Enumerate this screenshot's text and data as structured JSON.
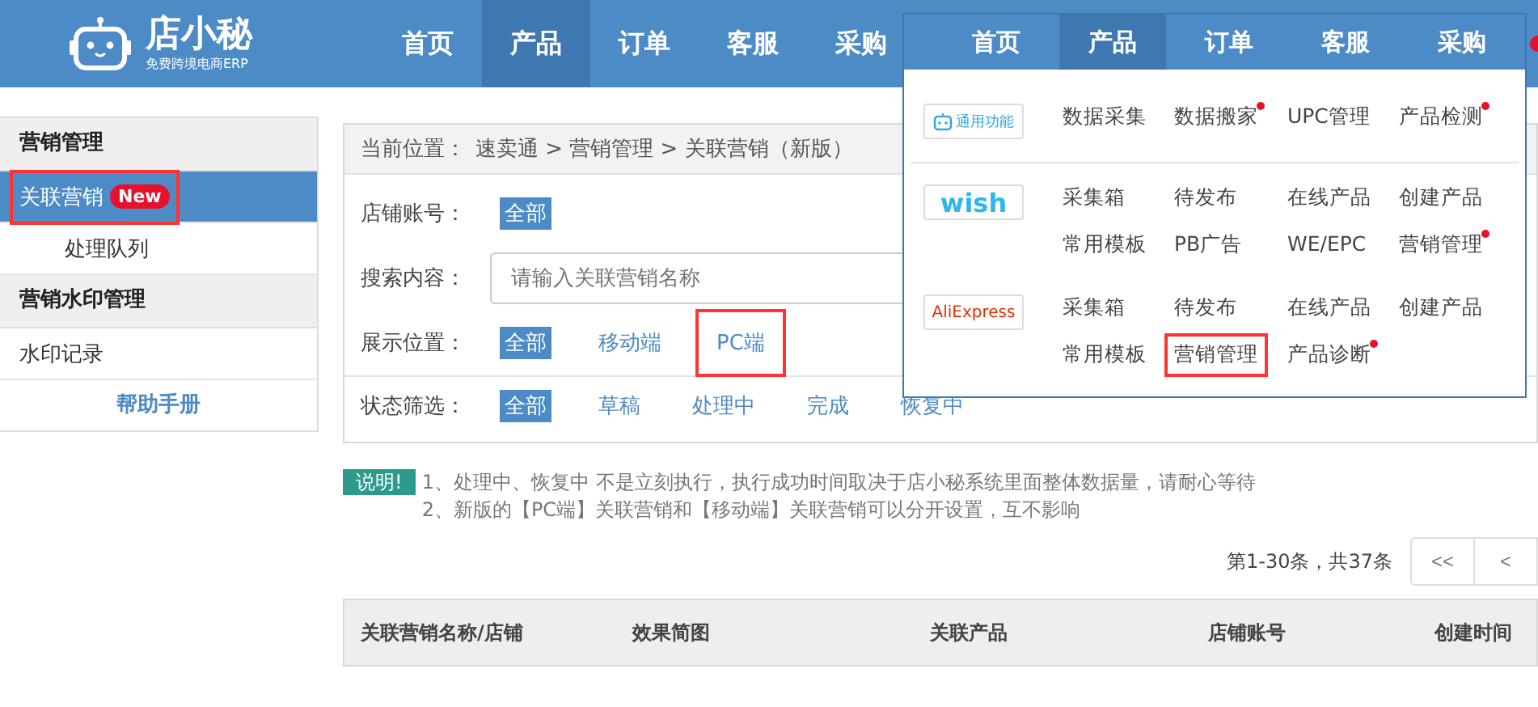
{
  "header": {
    "logo": {
      "name": "店小秘",
      "tagline": "免费跨境电商ERP"
    },
    "nav": [
      {
        "label": "首页",
        "selected": false
      },
      {
        "label": "产品",
        "selected": true
      },
      {
        "label": "订单",
        "selected": false
      },
      {
        "label": "客服",
        "selected": false
      },
      {
        "label": "采购",
        "selected": false
      }
    ]
  },
  "sidebar": [
    {
      "title": "营销管理",
      "items": [
        {
          "label": "关联营销",
          "badge": "New",
          "selected": true,
          "highlighted": true,
          "sub": false
        },
        {
          "label": "处理队列",
          "selected": false,
          "highlighted": false,
          "sub": true
        }
      ]
    },
    {
      "title": "营销水印管理",
      "items": [
        {
          "label": "水印记录",
          "selected": false,
          "highlighted": false,
          "sub": false
        }
      ]
    }
  ],
  "help_link": "帮助手册",
  "breadcrumb": {
    "label": "当前位置：",
    "path": "速卖通 > 营销管理 > 关联营销（新版）"
  },
  "filters": [
    {
      "kind": "chips",
      "label": "店铺账号：",
      "options": [
        {
          "label": "全部",
          "selected": true,
          "highlighted": false
        }
      ]
    },
    {
      "kind": "search",
      "label": "搜索内容：",
      "placeholder": "请输入关联营销名称"
    },
    {
      "kind": "chips",
      "label": "展示位置：",
      "options": [
        {
          "label": "全部",
          "selected": true,
          "highlighted": false
        },
        {
          "label": "移动端",
          "selected": false,
          "highlighted": false
        },
        {
          "label": "PC端",
          "selected": false,
          "highlighted": true
        }
      ]
    },
    {
      "kind": "chips",
      "label": "状态筛选：",
      "options": [
        {
          "label": "全部",
          "selected": true,
          "highlighted": false
        },
        {
          "label": "草稿",
          "selected": false,
          "highlighted": false
        },
        {
          "label": "处理中",
          "selected": false,
          "highlighted": false
        },
        {
          "label": "完成",
          "selected": false,
          "highlighted": false
        },
        {
          "label": "恢复中",
          "selected": false,
          "highlighted": false
        }
      ]
    }
  ],
  "notice": {
    "badge": "说明!",
    "lines": [
      "1、处理中、恢复中 不是立刻执行，执行成功时间取决于店小秘系统里面整体数据量，请耐心等待",
      "2、新版的【PC端】关联营销和【移动端】关联营销可以分开设置，互不影响"
    ]
  },
  "pagination": {
    "summary": "第1-30条，共37条",
    "buttons": [
      "<<",
      "<"
    ]
  },
  "table": {
    "columns": [
      "关联营销名称/店铺",
      "效果简图",
      "关联产品",
      "店铺账号",
      "创建时间"
    ]
  },
  "dropdown": {
    "nav": [
      {
        "label": "首页",
        "selected": false
      },
      {
        "label": "产品",
        "selected": true
      },
      {
        "label": "订单",
        "selected": false
      },
      {
        "label": "客服",
        "selected": false
      },
      {
        "label": "采购",
        "selected": false
      }
    ],
    "sections": [
      {
        "kind": "general",
        "platform": "通用功能",
        "items": [
          {
            "label": "数据采集",
            "dot": false,
            "highlighted": false
          },
          {
            "label": "数据搬家",
            "dot": true,
            "highlighted": false
          },
          {
            "label": "UPC管理",
            "dot": false,
            "highlighted": false
          },
          {
            "label": "产品检测",
            "dot": true,
            "highlighted": false
          }
        ]
      },
      {
        "kind": "wish",
        "platform": "wish",
        "items": [
          {
            "label": "采集箱",
            "dot": false,
            "highlighted": false
          },
          {
            "label": "待发布",
            "dot": false,
            "highlighted": false
          },
          {
            "label": "在线产品",
            "dot": false,
            "highlighted": false
          },
          {
            "label": "创建产品",
            "dot": false,
            "highlighted": false
          },
          {
            "label": "常用模板",
            "dot": false,
            "highlighted": false
          },
          {
            "label": "PB广告",
            "dot": false,
            "highlighted": false
          },
          {
            "label": "WE/EPC",
            "dot": false,
            "highlighted": false
          },
          {
            "label": "营销管理",
            "dot": true,
            "highlighted": false
          }
        ]
      },
      {
        "kind": "aliexpress",
        "platform": "AliExpress",
        "items": [
          {
            "label": "采集箱",
            "dot": false,
            "highlighted": false
          },
          {
            "label": "待发布",
            "dot": false,
            "highlighted": false
          },
          {
            "label": "在线产品",
            "dot": false,
            "highlighted": false
          },
          {
            "label": "创建产品",
            "dot": false,
            "highlighted": false
          },
          {
            "label": "常用模板",
            "dot": false,
            "highlighted": false
          },
          {
            "label": "营销管理",
            "dot": false,
            "highlighted": true
          },
          {
            "label": "产品诊断",
            "dot": true,
            "highlighted": false
          }
        ]
      }
    ]
  }
}
